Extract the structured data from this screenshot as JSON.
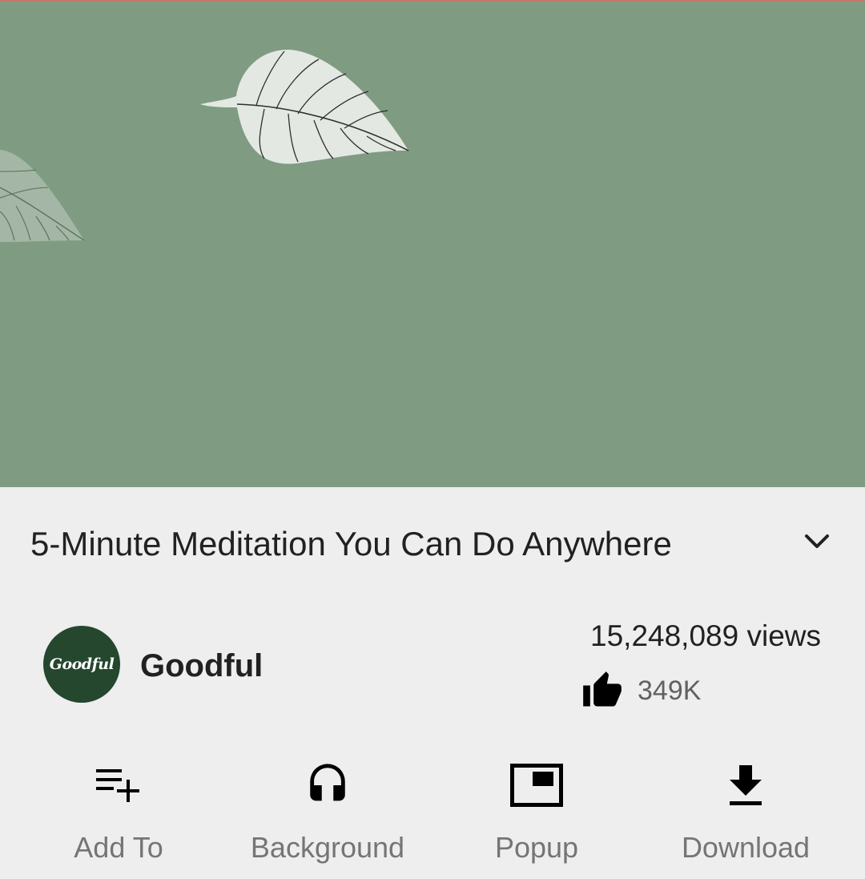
{
  "video": {
    "background_color": "#7f9c83"
  },
  "details": {
    "title": "5-Minute Meditation You Can Do Anywhere",
    "channel_name": "Goodful",
    "channel_avatar_text": "Goodful",
    "views": "15,248,089 views",
    "likes": "349K"
  },
  "actions": [
    {
      "label": "Add To",
      "icon": "playlist-add-icon"
    },
    {
      "label": "Background",
      "icon": "headphones-icon"
    },
    {
      "label": "Popup",
      "icon": "picture-in-picture-icon"
    },
    {
      "label": "Download",
      "icon": "download-icon"
    }
  ],
  "colors": {
    "panel_bg": "#eeeeee",
    "text_primary": "#212121",
    "text_secondary": "#757575",
    "avatar_bg": "#24472d"
  }
}
